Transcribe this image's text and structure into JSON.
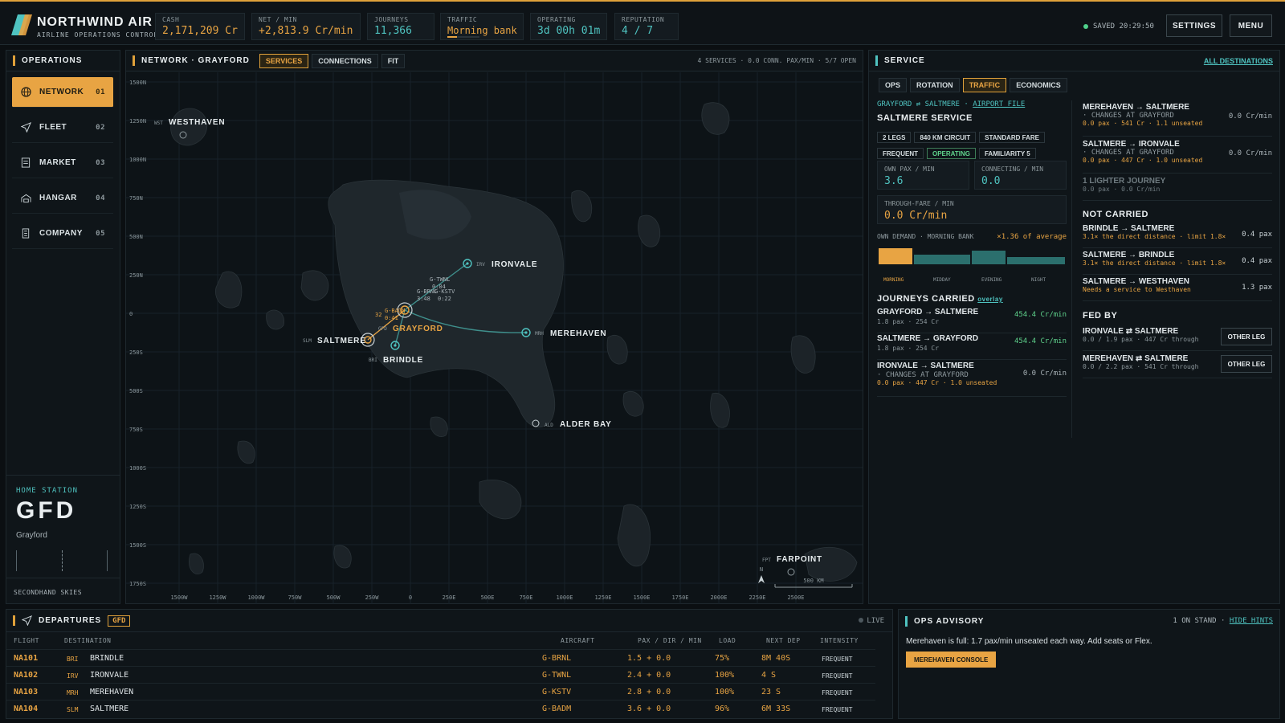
{
  "app": {
    "name": "NORTHWIND AIR",
    "subtitle": "AIRLINE OPERATIONS CONTROL"
  },
  "stats": [
    {
      "label": "CASH",
      "value": "2,171,209 Cr"
    },
    {
      "label": "NET / MIN",
      "value": "+2,813.9 Cr/min"
    },
    {
      "label": "JOURNEYS",
      "value": "11,366"
    },
    {
      "label": "TRAFFIC",
      "value": "Morning bank"
    },
    {
      "label": "OPERATING",
      "value": "3d 00h 01m"
    },
    {
      "label": "REPUTATION",
      "value": "4 / 7"
    }
  ],
  "traffic_progress": 0.3,
  "saved": "SAVED 20:29:50",
  "top_buttons": {
    "settings": "SETTINGS",
    "menu": "MENU"
  },
  "operations": {
    "title": "OPERATIONS",
    "items": [
      {
        "label": "NETWORK",
        "num": "01",
        "icon": "globe-icon"
      },
      {
        "label": "FLEET",
        "num": "02",
        "icon": "plane-icon"
      },
      {
        "label": "MARKET",
        "num": "03",
        "icon": "document-icon"
      },
      {
        "label": "HANGAR",
        "num": "04",
        "icon": "hangar-icon"
      },
      {
        "label": "COMPANY",
        "num": "05",
        "icon": "building-icon"
      }
    ],
    "home_label": "HOME STATION",
    "home_code": "GFD",
    "home_name": "Grayford",
    "footer": "SECONDHAND SKIES"
  },
  "network": {
    "title": "NETWORK · GRAYFORD",
    "tabs": [
      "SERVICES",
      "CONNECTIONS",
      "FIT"
    ],
    "summary": "4 SERVICES · 0.0 CONN. PAX/MIN · 5/7 OPEN",
    "airports": [
      {
        "code": "WST",
        "name": "WESTHAVEN"
      },
      {
        "code": "IRV",
        "name": "IRONVALE"
      },
      {
        "code": "MRH",
        "name": "MEREHAVEN"
      },
      {
        "code": "GFD",
        "name": "GRAYFORD"
      },
      {
        "code": "SLM",
        "name": "SALTMERE"
      },
      {
        "code": "BRI",
        "name": "BRINDLE"
      },
      {
        "code": "ALD",
        "name": "ALDER BAY"
      },
      {
        "code": "FPT",
        "name": "FARPOINT"
      }
    ],
    "flight_tags": [
      "G-TWNL",
      "0:04",
      "G-BRNL",
      "3:48",
      "G-KSTV",
      "0:22",
      "G-BADM",
      "0:41",
      "32"
    ],
    "y_ticks": [
      "1500N",
      "1250N",
      "1000N",
      "750N",
      "500N",
      "250N",
      "0",
      "250S",
      "500S",
      "750S",
      "1000S",
      "1250S",
      "1500S",
      "1750S"
    ],
    "x_ticks": [
      "1500W",
      "1250W",
      "1000W",
      "750W",
      "500W",
      "250W",
      "0",
      "250E",
      "500E",
      "750E",
      "1000E",
      "1250E",
      "1500E",
      "1750E",
      "2000E",
      "2250E",
      "2500E"
    ],
    "north": "N",
    "scale": "500 KM"
  },
  "service": {
    "title": "SERVICE",
    "all_link": "ALL DESTINATIONS",
    "tabs": [
      "OPS",
      "ROTATION",
      "TRAFFIC",
      "ECONOMICS"
    ],
    "route_line": "GRAYFORD ⇄ SALTMERE ·",
    "airport_file": "AIRPORT FILE",
    "name": "SALTMERE SERVICE",
    "tags1": [
      "2 LEGS",
      "840 KM CIRCUIT",
      "STANDARD FARE"
    ],
    "tags2": [
      "FREQUENT",
      "OPERATING",
      "FAMILIARITY 5"
    ],
    "own_pax_label": "OWN PAX / MIN",
    "own_pax": "3.6",
    "connecting_label": "CONNECTING / MIN",
    "connecting": "0.0",
    "through_label": "THROUGH-FARE / MIN",
    "through": "0.0 Cr/min",
    "demand_label": "OWN DEMAND · MORNING BANK",
    "demand_mult": "×1.36 of average",
    "demand_periods": [
      "MORNING",
      "MIDDAY",
      "EVENING",
      "NIGHT"
    ],
    "demand_levels": [
      1.0,
      0.62,
      0.85,
      0.45
    ],
    "journeys_title": "JOURNEYS CARRIED",
    "overlay": "overlay",
    "journeys": [
      {
        "route": "GRAYFORD → SALTMERE",
        "sub": "1.8 pax · 254 Cr",
        "value": "454.4 Cr/min",
        "note": ""
      },
      {
        "route": "SALTMERE → GRAYFORD",
        "sub": "1.8 pax · 254 Cr",
        "value": "454.4 Cr/min",
        "note": ""
      },
      {
        "route": "IRONVALE → SALTMERE",
        "sub": "0.0 pax · 447 Cr · 1.0 unseated",
        "value": "0.0 Cr/min",
        "note": "· CHANGES AT GRAYFORD"
      }
    ],
    "right_journeys": [
      {
        "route": "MEREHAVEN → SALTMERE",
        "note": "· CHANGES AT GRAYFORD",
        "sub": "0.0 pax · 541 Cr · 1.1 unseated",
        "value": "0.0 Cr/min"
      },
      {
        "route": "SALTMERE → IRONVALE",
        "note": "· CHANGES AT GRAYFORD",
        "sub": "0.0 pax · 447 Cr · 1.0 unseated",
        "value": "0.0 Cr/min"
      }
    ],
    "lighter": "1 LIGHTER JOURNEY",
    "lighter_sub": "0.0 pax · 0.0 Cr/min",
    "not_carried_title": "NOT CARRIED",
    "not_carried": [
      {
        "route": "BRINDLE → SALTMERE",
        "sub": "3.1× the direct distance · limit 1.8×",
        "value": "0.4 pax"
      },
      {
        "route": "SALTMERE → BRINDLE",
        "sub": "3.1× the direct distance · limit 1.8×",
        "value": "0.4 pax"
      },
      {
        "route": "SALTMERE → WESTHAVEN",
        "sub": "Needs a service to Westhaven",
        "value": "1.3 pax"
      }
    ],
    "fed_by_title": "FED BY",
    "fed_by": [
      {
        "route": "IRONVALE ⇄ SALTMERE",
        "sub": "0.0 / 1.9 pax · 447 Cr through",
        "button": "OTHER LEG"
      },
      {
        "route": "MEREHAVEN ⇄ SALTMERE",
        "sub": "0.0 / 2.2 pax · 541 Cr through",
        "button": "OTHER LEG"
      }
    ]
  },
  "departures": {
    "title": "DEPARTURES",
    "badge": "GFD",
    "live": "LIVE",
    "columns": [
      "FLIGHT",
      "DESTINATION",
      "AIRCRAFT",
      "PAX / DIR / MIN",
      "LOAD",
      "NEXT DEP",
      "INTENSITY"
    ],
    "rows": [
      {
        "flight": "NA101",
        "code": "BRI",
        "dest": "BRINDLE",
        "aircraft": "G-BRNL",
        "pax": "1.5 + 0.0",
        "load": "75%",
        "next": "8M 40S",
        "intensity": "FREQUENT"
      },
      {
        "flight": "NA102",
        "code": "IRV",
        "dest": "IRONVALE",
        "aircraft": "G-TWNL",
        "pax": "2.4 + 0.0",
        "load": "100%",
        "next": "4 S",
        "intensity": "FREQUENT"
      },
      {
        "flight": "NA103",
        "code": "MRH",
        "dest": "MEREHAVEN",
        "aircraft": "G-KSTV",
        "pax": "2.8 + 0.0",
        "load": "100%",
        "next": "23 S",
        "intensity": "FREQUENT"
      },
      {
        "flight": "NA104",
        "code": "SLM",
        "dest": "SALTMERE",
        "aircraft": "G-BADM",
        "pax": "3.6 + 0.0",
        "load": "96%",
        "next": "6M 33S",
        "intensity": "FREQUENT"
      }
    ]
  },
  "advisory": {
    "title": "OPS ADVISORY",
    "stand": "1 ON STAND ·",
    "hide": "HIDE HINTS",
    "message": "Merehaven is full: 1.7 pax/min unseated each way. Add seats or Flex.",
    "button": "MEREHAVEN CONSOLE"
  },
  "colors": {
    "accent": "#e8a443",
    "teal": "#4fc3c0",
    "green": "#5fd38c"
  }
}
